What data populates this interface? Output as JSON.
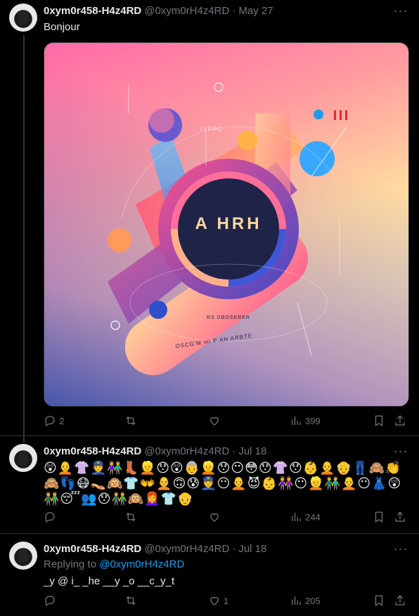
{
  "tweets": [
    {
      "name": "0xym0r458-H4z4RD",
      "handle": "@0xym0rH4z4RD",
      "dot": "·",
      "date": "May 27",
      "text": "Bonjour",
      "image": {
        "center_text": "A HRH",
        "caption1": "RS DBOSERER",
        "caption2": "OSCG'M  HI  P AN ARBTE",
        "top_text": "IYPPO"
      },
      "replies": "2",
      "retweets": "",
      "likes": "",
      "views": "399"
    },
    {
      "name": "0xym0r458-H4z4RD",
      "handle": "@0xym0rH4z4RD",
      "dot": "·",
      "date": "Jul 18",
      "emojis": "😲🧑‍🦲👚👮👫👢👱😯😲👵👱😯😶😳😯👚😯👶🧑‍🦲👴👖🙈👏🙈👣😷👡🙉👕👐🧑‍🦲🙃😰👮😶🧑‍🦲😈👶👭😶👱👬🧑‍🦲😶👗😲👬😴👥😯👬🙉👩‍🦰👕👴",
      "replies": "",
      "retweets": "",
      "likes": "",
      "views": "244"
    },
    {
      "name": "0xym0r458-H4z4RD",
      "handle": "@0xym0rH4z4RD",
      "dot": "·",
      "date": "Jul 18",
      "replying_prefix": "Replying to",
      "replying_to": "@0xym0rH4z4RD",
      "text": "_y @ i_ _he __y _o __c_y_t",
      "replies": "",
      "retweets": "",
      "likes": "1",
      "views": "205"
    }
  ],
  "icons": {
    "more": "more-horizontal-icon",
    "reply": "reply-icon",
    "retweet": "retweet-icon",
    "like": "heart-icon",
    "views": "views-icon",
    "bookmark": "bookmark-icon",
    "share": "share-icon"
  }
}
